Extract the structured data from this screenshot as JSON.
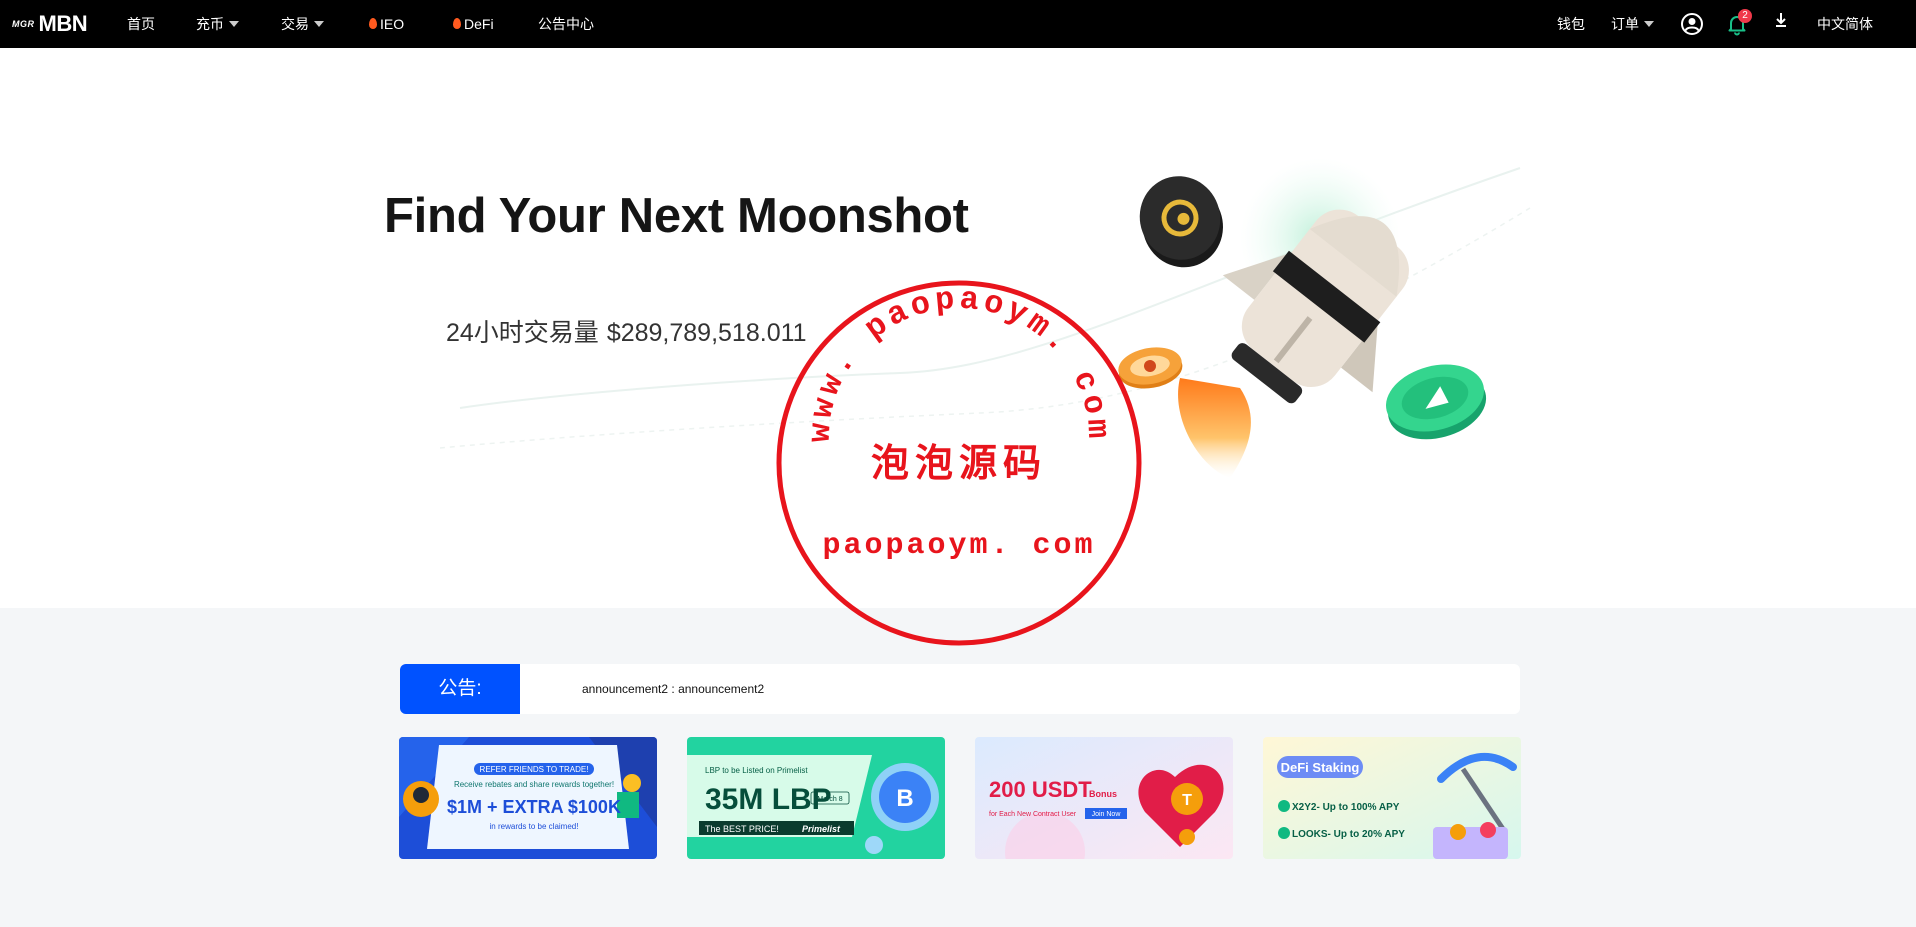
{
  "nav": {
    "logo_small": "MGR",
    "logo_big": "MBN",
    "items": [
      {
        "label": "首页"
      },
      {
        "label": "充币"
      },
      {
        "label": "交易"
      },
      {
        "label": "IEO"
      },
      {
        "label": "DeFi"
      },
      {
        "label": "公告中心"
      }
    ],
    "right": {
      "wallet": "钱包",
      "orders": "订单",
      "notification_count": "2",
      "language": "中文简体"
    }
  },
  "hero": {
    "title": "Find Your Next Moonshot",
    "volume_label": "24小时交易量",
    "volume_value": "$289,789,518.011"
  },
  "watermark": {
    "arc_text": "www. paopaoym. com",
    "center_text": "泡泡源码",
    "bottom_text": "paopaoym. com"
  },
  "announcement": {
    "label": "公告:",
    "text": "announcement2 : announcement2"
  },
  "banners": [
    {
      "line1": "REFER FRIENDS TO TRADE!",
      "line2": "Receive rebates and share rewards together!",
      "line3": "$1M + EXTRA $100K",
      "line4": "in rewards to be claimed!"
    },
    {
      "line1": "LBP to be Listed on Primelist",
      "line2": "35M LBP",
      "line3": "March 8",
      "line4": "The BEST PRICE!",
      "line5": "Primelist"
    },
    {
      "line1": "200 USDT",
      "line2": "Bonus",
      "line3": "for Each New Contract User",
      "line4": "Join Now"
    },
    {
      "line1": "DeFi Staking",
      "line2": "X2Y2- Up to 100% APY",
      "line3": "LOOKS- Up to 20% APY"
    }
  ],
  "colors": {
    "topbar": "#000000",
    "accent": "#0052ff",
    "badge": "#f0394a",
    "stamp": "#e8141c"
  },
  "icons": [
    "user-icon",
    "bell-icon",
    "download-icon",
    "caret-down-icon",
    "fire-icon"
  ]
}
